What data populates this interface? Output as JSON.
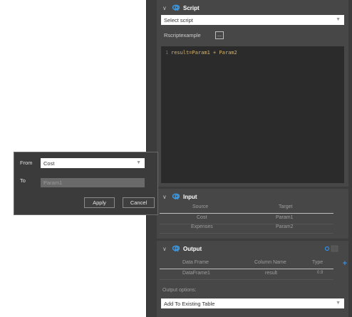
{
  "script_section": {
    "title": "Script",
    "select_value": "Select script",
    "rscript_label": "Rscriptexample",
    "dots_label": "...",
    "code_line_no": "1",
    "code_text": "result=Param1 + Param2"
  },
  "input_section": {
    "title": "Input",
    "columns": [
      "Source",
      "Target"
    ],
    "rows": [
      [
        "Cost",
        "Param1"
      ],
      [
        "Expenses",
        "Param2"
      ]
    ]
  },
  "output_section": {
    "title": "Output",
    "columns": [
      "Data Frame",
      "Column Name",
      "Type"
    ],
    "rows": [
      [
        "DataFrame1",
        "result",
        "0.9"
      ]
    ],
    "options_label": "Output options:",
    "options_value": "Add To Existing Table",
    "add_symbol": "+"
  },
  "dialog": {
    "from_label": "From",
    "from_value": "Cost",
    "to_label": "To",
    "to_value": "Param1",
    "apply_label": "Apply",
    "cancel_label": "Cancel"
  },
  "colors": {
    "accent": "#2f8ee6",
    "panel_bg": "#3c3c3c",
    "section_bg": "#474747",
    "editor_bg": "#2b2b2b",
    "code_color": "#d6b36a"
  },
  "icons": {
    "section_icon": "r-logo-icon",
    "collapse": "chevron-down-icon",
    "dropdown": "caret-down-icon",
    "add": "plus-icon",
    "settings": "settings-icon"
  }
}
